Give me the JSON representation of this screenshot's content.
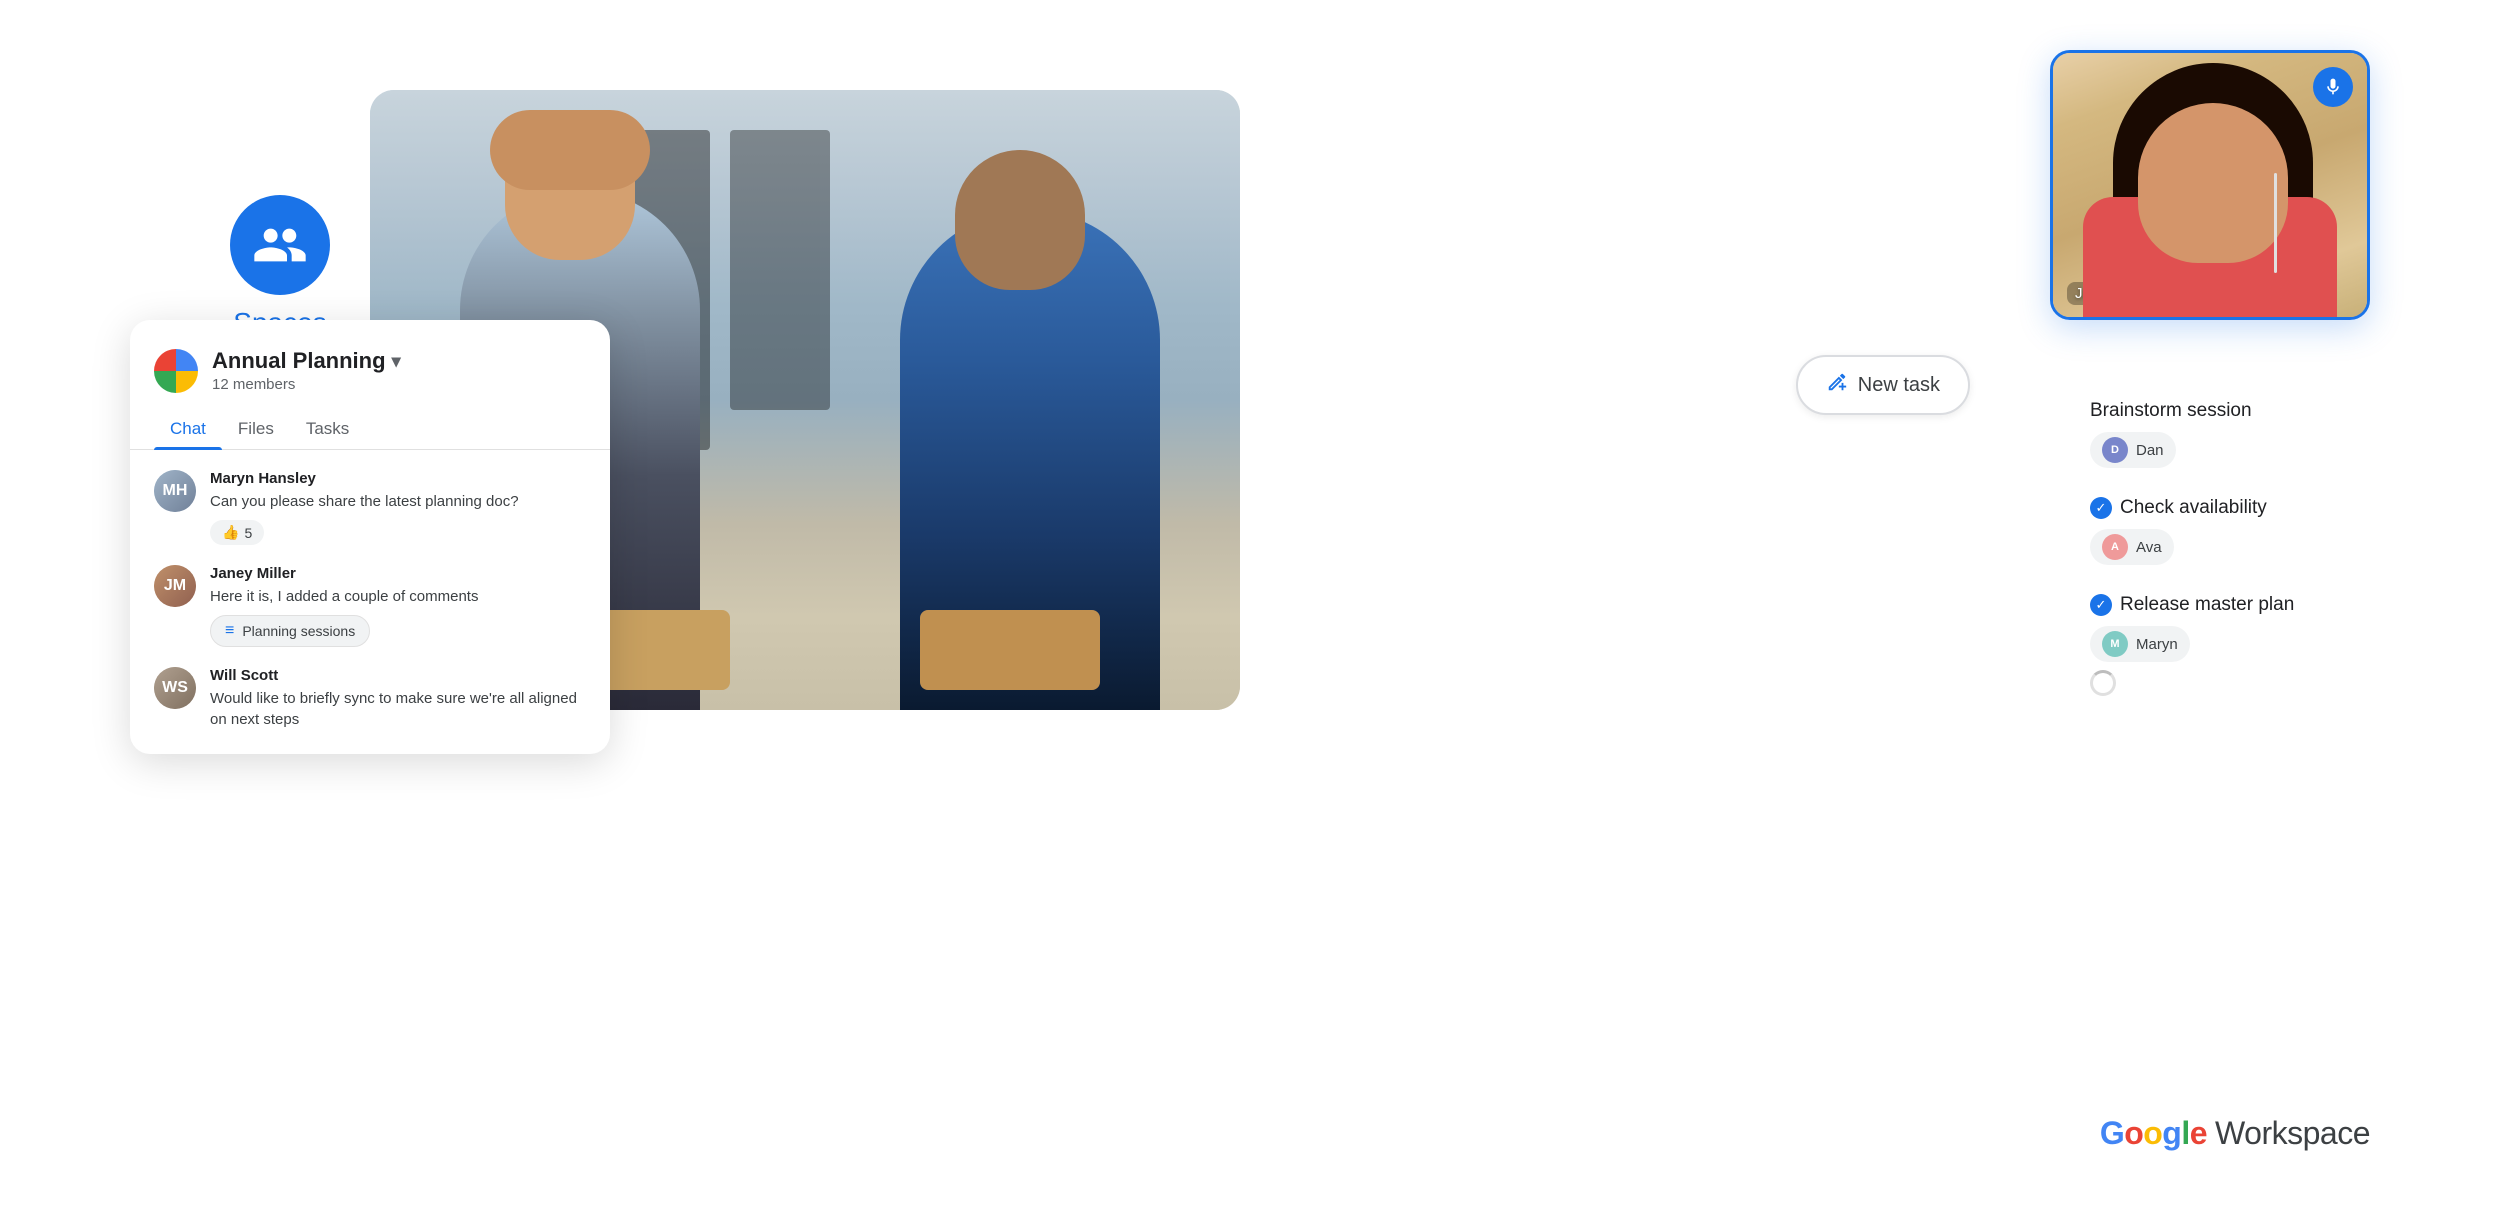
{
  "spaces": {
    "icon_label": "Spaces"
  },
  "chat_panel": {
    "title": "Annual Planning",
    "members": "12 members",
    "tabs": [
      {
        "label": "Chat",
        "active": true
      },
      {
        "label": "Files",
        "active": false
      },
      {
        "label": "Tasks",
        "active": false
      }
    ],
    "messages": [
      {
        "sender": "Maryn Hansley",
        "initials": "MH",
        "text": "Can you please share the latest planning doc?",
        "reaction": "5",
        "reaction_emoji": "👍"
      },
      {
        "sender": "Janey Miller",
        "initials": "JM",
        "text": "Here it is, I added a couple of comments",
        "file_chip": "Planning sessions"
      },
      {
        "sender": "Will Scott",
        "initials": "WS",
        "text": "Would like to briefly sync to make sure we're all aligned on next steps",
        "file_chip": null
      }
    ]
  },
  "video_call": {
    "person_name": "Janey Miller"
  },
  "new_task": {
    "label": "New task"
  },
  "tasks": [
    {
      "title": "Brainstorm session",
      "assignee": "Dan",
      "checked": false
    },
    {
      "title": "Check availability",
      "assignee": "Ava",
      "checked": true
    },
    {
      "title": "Release master plan",
      "assignee": "Maryn",
      "checked": true
    }
  ],
  "google_workspace": {
    "google_text": "Google",
    "workspace_text": "Workspace"
  }
}
